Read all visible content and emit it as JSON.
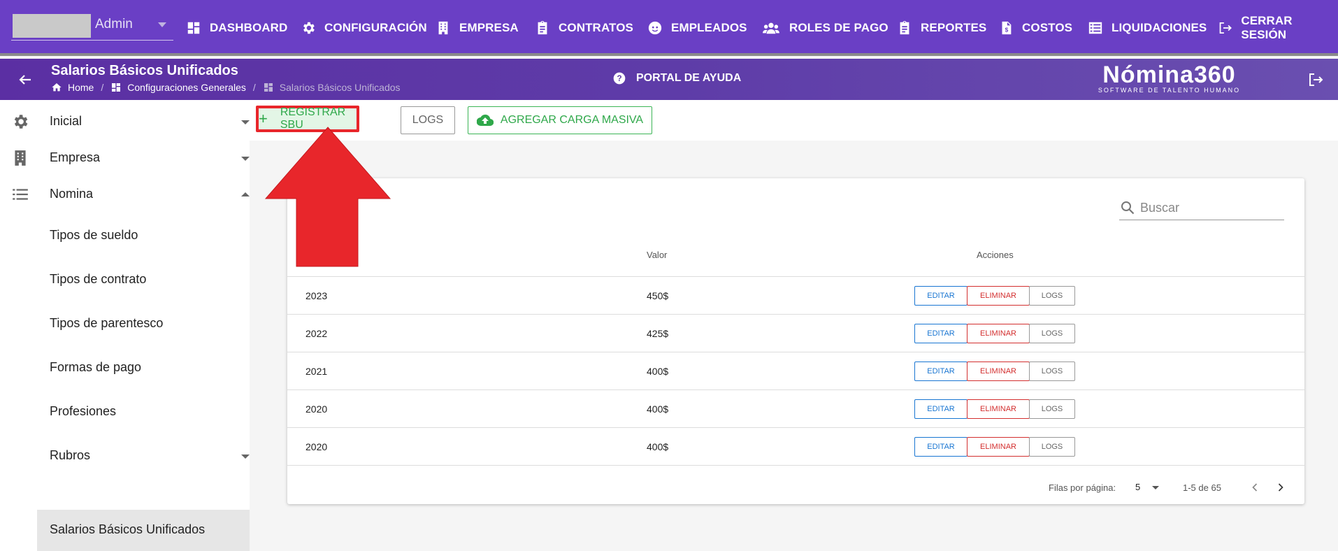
{
  "colors": {
    "nav": "#6a3fc5",
    "accent_green": "#2fa84a",
    "annotation_red": "#e8262b",
    "edit_blue": "#1976d2",
    "delete_red": "#d32f2f"
  },
  "user": {
    "name": "Admin"
  },
  "nav": {
    "dashboard": "DASHBOARD",
    "configuracion": "CONFIGURACIÓN",
    "empresa": "EMPRESA",
    "contratos": "CONTRATOS",
    "empleados": "EMPLEADOS",
    "roles": "ROLES DE PAGO",
    "reportes": "REPORTES",
    "costos": "COSTOS",
    "liquidaciones": "LIQUIDACIONES",
    "cerrar": "CERRAR SESIÓN"
  },
  "header": {
    "title": "Salarios Básicos Unificados",
    "crumb_home": "Home",
    "crumb_config": "Configuraciones Generales",
    "crumb_current": "Salarios Básicos Unificados",
    "help": "PORTAL DE AYUDA",
    "logo_title": "Nómina360",
    "logo_sub": "SOFTWARE DE TALENTO HUMANO"
  },
  "sidebar": {
    "inicial": "Inicial",
    "empresa": "Empresa",
    "nomina": "Nomina",
    "tipos_sueldo": "Tipos de sueldo",
    "tipos_contrato": "Tipos de contrato",
    "tipos_parentesco": "Tipos de parentesco",
    "formas_pago": "Formas de pago",
    "profesiones": "Profesiones",
    "rubros": "Rubros",
    "sbu": "Salarios Básicos Unificados"
  },
  "toolbar": {
    "registrar": "REGISTRAR SBU",
    "logs": "LOGS",
    "carga": "AGREGAR CARGA MASIVA"
  },
  "table": {
    "search_placeholder": "Buscar",
    "col_valor": "Valor",
    "col_acciones": "Acciones",
    "btn_editar": "EDITAR",
    "btn_eliminar": "ELIMINAR",
    "btn_logs": "LOGS",
    "rows": [
      {
        "year": "2023",
        "value": "450$"
      },
      {
        "year": "2022",
        "value": "425$"
      },
      {
        "year": "2021",
        "value": "400$"
      },
      {
        "year": "2020",
        "value": "400$"
      },
      {
        "year": "2020",
        "value": "400$"
      }
    ],
    "rows_per_page_label": "Filas por página:",
    "rows_per_page": "5",
    "range": "1-5 de 65"
  }
}
